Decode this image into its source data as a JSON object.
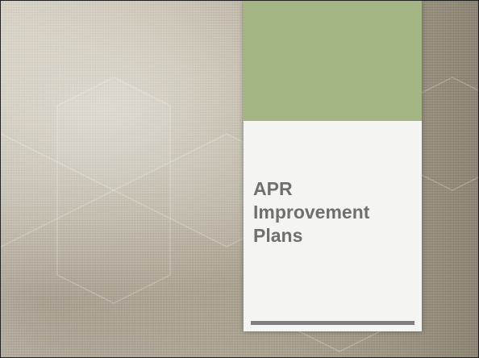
{
  "slide": {
    "title": "APR\nImprovement\nPlans"
  },
  "colors": {
    "accent_band": "#a4b584",
    "card_background": "#f4f4f2",
    "title_text": "#6f6f6f",
    "rule": "#7e7e80",
    "background_base": "#b3a995"
  }
}
